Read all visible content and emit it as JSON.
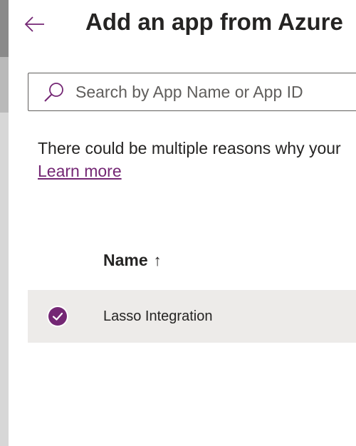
{
  "header": {
    "back_icon": "arrow-left-icon",
    "title": "Add an app from Azure"
  },
  "search": {
    "icon": "search-icon",
    "placeholder": "Search by App Name or App ID",
    "value": ""
  },
  "info": {
    "text": "There could be multiple reasons why your",
    "link_label": "Learn more"
  },
  "table": {
    "columns": [
      {
        "label": "Name",
        "sort_icon": "sort-ascending-icon",
        "sort_glyph": "↑"
      }
    ],
    "rows": [
      {
        "name": "Lasso Integration",
        "selected": true,
        "select_icon": "checkmark-circle-icon"
      }
    ]
  },
  "colors": {
    "accent": "#742774",
    "row_selected_bg": "#edebe9",
    "text": "#252423"
  }
}
